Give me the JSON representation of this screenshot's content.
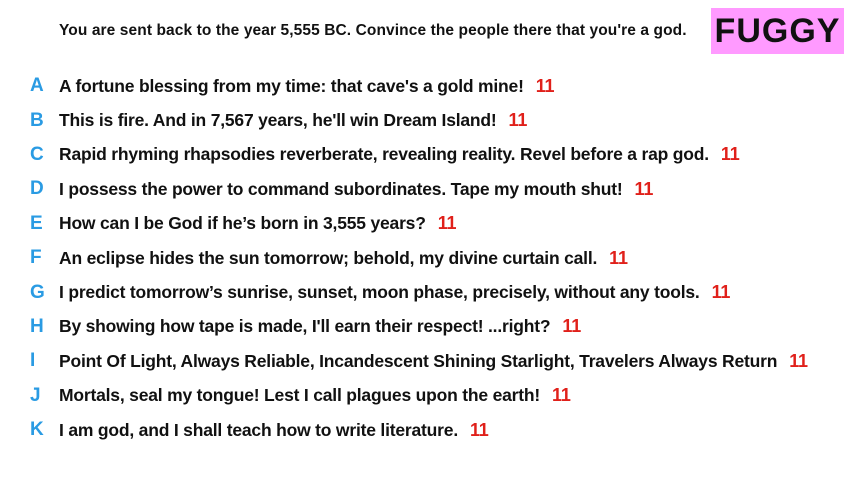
{
  "prompt": "You are sent back to the year 5,555 BC. Convince the people there that you're a god.",
  "player_name": "FUGGY",
  "colors": {
    "letter": "#2a9be3",
    "score": "#e0201a",
    "badge": "#ff9aff"
  },
  "entries": [
    {
      "letter": "A",
      "text": "A fortune blessing from my time: that cave's a gold mine!",
      "score": "11"
    },
    {
      "letter": "B",
      "text": "This is fire. And in 7,567 years, he'll win Dream Island!",
      "score": "11"
    },
    {
      "letter": "C",
      "text": "Rapid rhyming rhapsodies reverberate, revealing reality. Revel before a rap god.",
      "score": "11"
    },
    {
      "letter": "D",
      "text": "I possess the power to command subordinates. Tape my mouth shut!",
      "score": "11"
    },
    {
      "letter": "E",
      "text": "How can I be God if he’s born in 3,555 years?",
      "score": "11"
    },
    {
      "letter": "F",
      "text": "An eclipse hides the sun tomorrow; behold, my divine curtain call.",
      "score": "11"
    },
    {
      "letter": "G",
      "text": "I predict tomorrow’s sunrise, sunset, moon phase, precisely, without any tools.",
      "score": "11"
    },
    {
      "letter": "H",
      "text": "By showing how tape is made, I'll earn their respect! ...right?",
      "score": "11"
    },
    {
      "letter": "I",
      "text": "Point Of Light, Always Reliable, Incandescent Shining Starlight, Travelers Always Return",
      "score": "11"
    },
    {
      "letter": "J",
      "text": "Mortals, seal my tongue! Lest I call plagues upon the earth!",
      "score": "11"
    },
    {
      "letter": "K",
      "text": "I am god, and I shall teach how to write literature.",
      "score": "11"
    }
  ]
}
